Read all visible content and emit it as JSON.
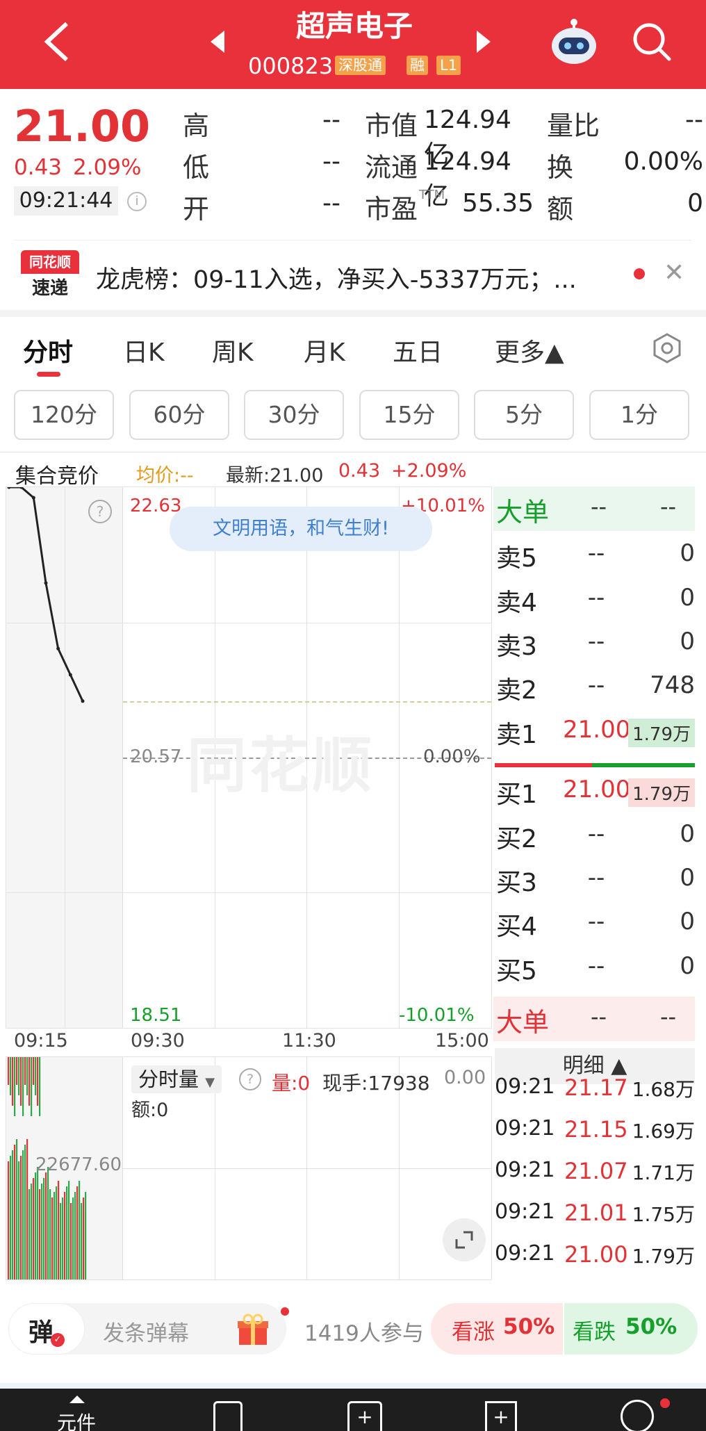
{
  "header": {
    "title": "超声电子",
    "code": "000823",
    "tag_hk": "深股通",
    "tag_margin": "融",
    "tag_level": "L1"
  },
  "quote": {
    "price": "21.00",
    "change": "0.43",
    "change_pct": "2.09%",
    "time": "09:21:44",
    "rows": [
      {
        "l1": "高",
        "v1": "--",
        "l2": "市值",
        "v2": "124.94亿",
        "l3": "量比",
        "v3": "--"
      },
      {
        "l1": "低",
        "v1": "--",
        "l2": "流通",
        "v2": "124.94亿",
        "l3": "换",
        "v3": "0.00%"
      },
      {
        "l1": "开",
        "v1": "--",
        "l2": "市盈",
        "l2sup": "TTM",
        "v2": "55.35",
        "l3": "额",
        "v3": "0"
      }
    ]
  },
  "news": {
    "logo_top": "同花顺",
    "logo_bottom": "速递",
    "text": "龙虎榜：09-11入选，净买入-5337万元；..."
  },
  "kline_tabs": [
    "分时",
    "日K",
    "周K",
    "月K",
    "五日",
    "更多▲"
  ],
  "period_tabs": [
    "120分",
    "60分",
    "30分",
    "15分",
    "5分",
    "1分"
  ],
  "info_bar": {
    "section": "集合竞价",
    "avg": "均价:--",
    "latest": "最新:21.00",
    "chg": "0.43",
    "chg_pct": "+2.09%"
  },
  "chart": {
    "y_high": "22.63",
    "y_high_pct": "+10.01%",
    "y_mid": "20.57",
    "y_mid_pct": "0.00%",
    "y_low": "18.51",
    "y_low_pct": "-10.01%",
    "banner": "文明用语，和气生财!",
    "watermark": "同花顺",
    "x_labels": [
      "09:15",
      "09:30",
      "11:30",
      "15:00"
    ]
  },
  "chart_data": {
    "type": "line",
    "title": "",
    "x": [
      "09:15",
      "09:16",
      "09:17",
      "09:18",
      "09:19",
      "09:20",
      "09:21"
    ],
    "series": [
      {
        "values": [
          22.63,
          22.63,
          22.55,
          21.9,
          21.4,
          21.2,
          21.0
        ]
      }
    ],
    "ylim": [
      18.51,
      22.63
    ]
  },
  "volume": {
    "label": "分时量",
    "qty": "量:0",
    "hand": "现手:17938",
    "right_val": "0.00",
    "amount": "额:0",
    "auction_vol": "22677.60"
  },
  "orderbook": {
    "big_label": "大单",
    "big_v1": "--",
    "big_v2": "--",
    "sell": [
      {
        "label": "卖5",
        "price": "--",
        "qty": "0"
      },
      {
        "label": "卖4",
        "price": "--",
        "qty": "0"
      },
      {
        "label": "卖3",
        "price": "--",
        "qty": "0"
      },
      {
        "label": "卖2",
        "price": "--",
        "qty": "748"
      },
      {
        "label": "卖1",
        "price": "21.00",
        "qty": "1.79万"
      }
    ],
    "buy": [
      {
        "label": "买1",
        "price": "21.00",
        "qty": "1.79万"
      },
      {
        "label": "买2",
        "price": "--",
        "qty": "0"
      },
      {
        "label": "买3",
        "price": "--",
        "qty": "0"
      },
      {
        "label": "买4",
        "price": "--",
        "qty": "0"
      },
      {
        "label": "买5",
        "price": "--",
        "qty": "0"
      }
    ],
    "detail_title": "明细 ▲",
    "details": [
      {
        "time": "09:21",
        "price": "21.17",
        "qty": "1.68万"
      },
      {
        "time": "09:21",
        "price": "21.15",
        "qty": "1.69万"
      },
      {
        "time": "09:21",
        "price": "21.07",
        "qty": "1.71万"
      },
      {
        "time": "09:21",
        "price": "21.01",
        "qty": "1.75万"
      },
      {
        "time": "09:21",
        "price": "21.00",
        "qty": "1.79万"
      }
    ]
  },
  "danmaku": {
    "button": "弹",
    "placeholder": "发条弹幕",
    "participants": "1419人参与",
    "up": "看涨",
    "up_pct": "50%",
    "down": "看跌",
    "down_pct": "50%"
  },
  "bottom_nav": {
    "first_label": "元件"
  }
}
